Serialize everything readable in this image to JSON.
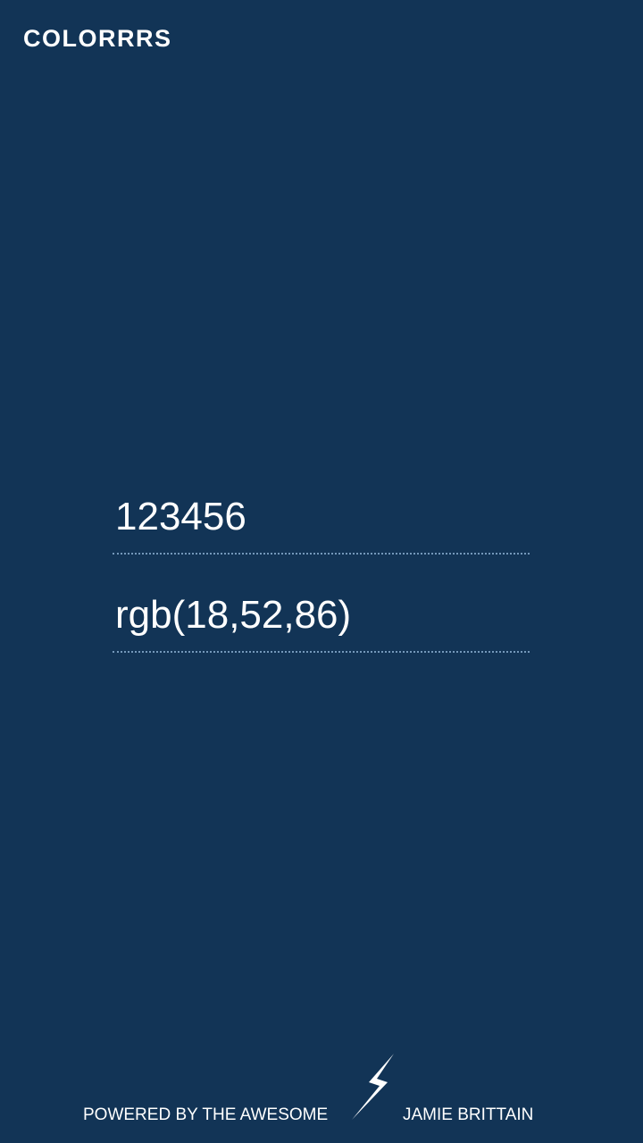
{
  "app": {
    "title": "COLORRRS",
    "background_color": "#123456"
  },
  "color_inputs": {
    "hex_value": "123456",
    "rgb_value": "rgb(18,52,86)"
  },
  "footer": {
    "powered_text": "POWERED BY THE AWESOME",
    "icon": "lightning-bolt-icon",
    "author_text": "JAMIE BRITTAIN"
  }
}
